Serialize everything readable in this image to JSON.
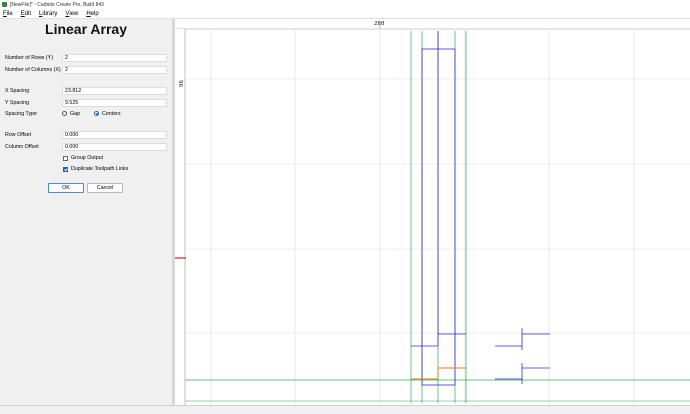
{
  "window": {
    "title": "[NewFile]* - Carbide Create Pro, Build 843"
  },
  "menu": [
    "File",
    "Edit",
    "Library",
    "View",
    "Help"
  ],
  "panel": {
    "heading": "Linear Array",
    "rows_label": "Number of Rows (Y)",
    "rows_value": "2",
    "cols_label": "Number of Columns (X)",
    "cols_value": "2",
    "xspacing_label": "X Spacing",
    "xspacing_value": "23.812",
    "yspacing_label": "Y Spacing",
    "yspacing_value": "9.525",
    "spacing_type_label": "Spacing Type",
    "spacing_gap": "Gap",
    "spacing_centers": "Centers",
    "spacing_selected": "Centers",
    "row_offset_label": "Row Offset",
    "row_offset_value": "0.000",
    "col_offset_label": "Column Offset",
    "col_offset_value": "0.000",
    "group_output_label": "Group Output",
    "group_output_checked": false,
    "dup_links_label": "Duplicate Toolpath Links",
    "dup_links_checked": true,
    "ok_label": "OK",
    "cancel_label": "Cancel"
  },
  "canvas": {
    "ruler_top_label": "288",
    "ruler_left_label": "96",
    "colors": {
      "grid": "#d8d8d8",
      "green": "#2fb04a",
      "blue": "#2d2ddc",
      "orange": "#f07a1a",
      "red": "#e02020"
    }
  }
}
